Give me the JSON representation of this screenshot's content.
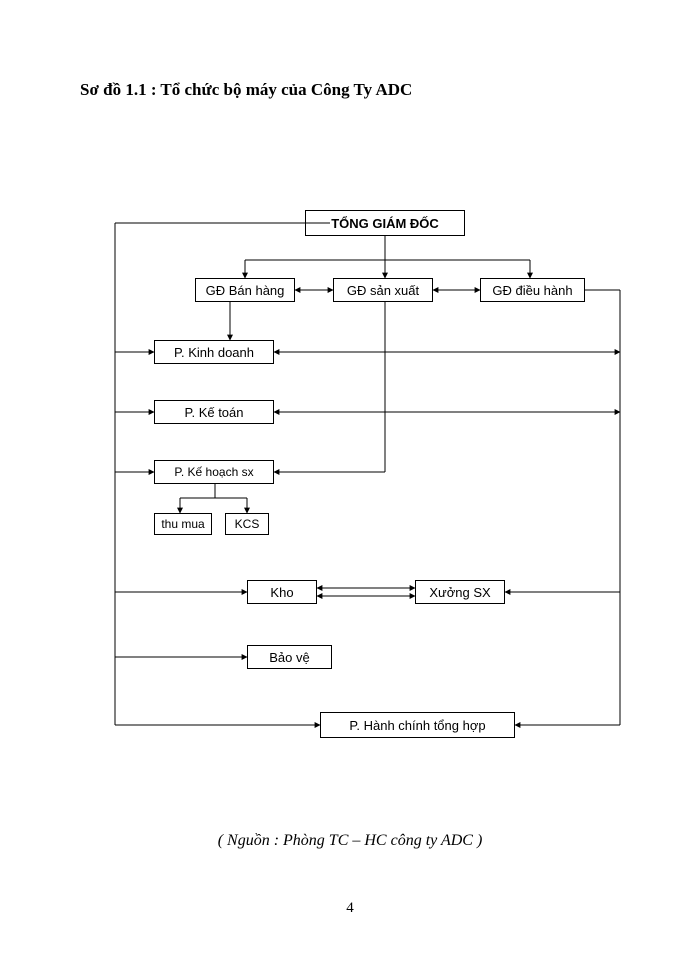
{
  "title": "Sơ đồ 1.1 : Tổ chức bộ máy của Công Ty ADC",
  "boxes": {
    "ceo": "TỔNG GIÁM ĐỐC",
    "gd_banhang": "GĐ Bán hàng",
    "gd_sanxuat": "GĐ sản xuất",
    "gd_dieuhanh": "GĐ điều hành",
    "p_kinhdoanh": "P. Kinh doanh",
    "p_ketoan": "P. Kế toán",
    "p_khsx": "P. Kế hoạch sx",
    "thumua": "thu mua",
    "kcs": "KCS",
    "kho": "Kho",
    "xuongsx": "Xưởng SX",
    "baove": "Bảo vệ",
    "p_hcth": "P. Hành chính tổng hợp"
  },
  "source": "( Nguồn : Phòng TC – HC công ty ADC )",
  "page_number": "4"
}
